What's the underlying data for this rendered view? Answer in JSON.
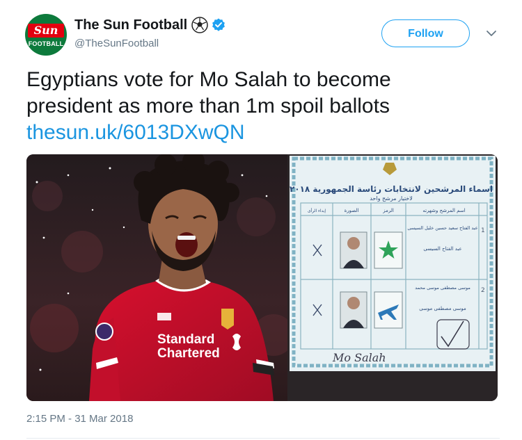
{
  "account": {
    "display_name": "The Sun Football",
    "handle": "@TheSunFootball",
    "avatar_logo_text": "Sun",
    "avatar_sub_text": "FOOTBALL",
    "verified": true
  },
  "actions": {
    "follow_label": "Follow"
  },
  "tweet": {
    "text_line1": "Egyptians vote for Mo Salah to become",
    "text_line2": "president as more than 1m spoil ballots",
    "link": "thesun.uk/6013DXwQN",
    "timestamp": "2:15 PM - 31 Mar 2018"
  },
  "media": {
    "shirt_sponsor_line1": "Standard",
    "shirt_sponsor_line2": "Chartered",
    "ballot_title": "اسماء المرشحين لانتخابات رئاسة الجمهورية ٢٠١٨",
    "ballot_subtitle": "لاختيار مرشح واحد",
    "ballot_headers": [
      "اسم المرشح وشهرته",
      "الرمز",
      "الصورة",
      "إبداء الرأى"
    ],
    "candidate_1_name": "عبد الفتاح سعيد حسين خليل السيسى",
    "candidate_1_alias": "عبد الفتاح السيسى",
    "candidate_2_name": "موسى مصطفى موسى محمد",
    "candidate_2_alias": "موسى مصطفى موسى",
    "handwriting": "Mo Salah"
  },
  "colors": {
    "accent": "#1da1f2",
    "link": "#1b95e0",
    "secondary_text": "#657786",
    "liverpool_red": "#c8102e",
    "ballot_paper": "#e8f1f4"
  }
}
